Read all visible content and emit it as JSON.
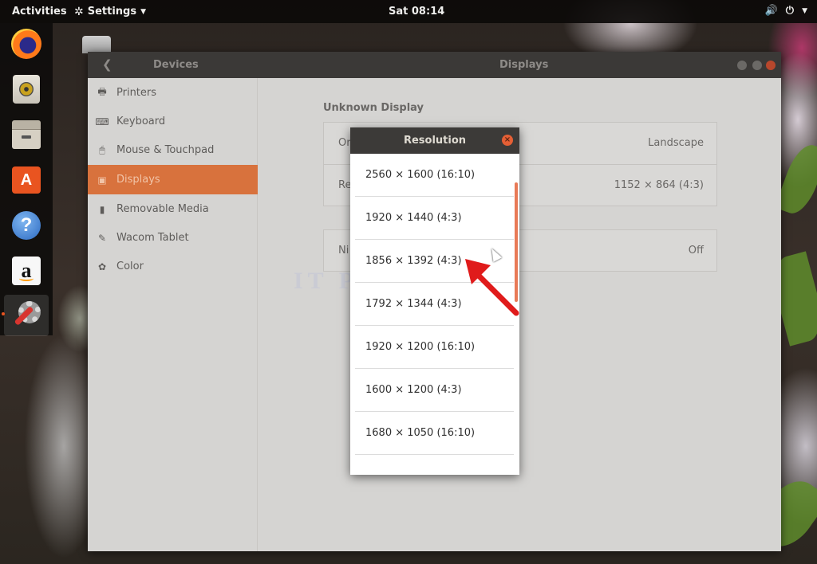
{
  "topbar": {
    "activities": "Activities",
    "app_menu": "Settings",
    "clock": "Sat 08:14"
  },
  "dock": {
    "items": [
      "firefox-icon",
      "rhythmbox-icon",
      "files-icon",
      "software-center-icon",
      "help-icon",
      "amazon-icon",
      "settings-icon"
    ],
    "active": "settings-icon"
  },
  "window": {
    "sidebar_title": "Devices",
    "title": "Displays",
    "sidebar": {
      "items": [
        {
          "label": "Printers",
          "icon": "printer-icon"
        },
        {
          "label": "Keyboard",
          "icon": "keyboard-icon"
        },
        {
          "label": "Mouse & Touchpad",
          "icon": "mouse-icon"
        },
        {
          "label": "Displays",
          "icon": "display-icon",
          "selected": true
        },
        {
          "label": "Removable Media",
          "icon": "usb-icon"
        },
        {
          "label": "Wacom Tablet",
          "icon": "tablet-icon"
        },
        {
          "label": "Color",
          "icon": "color-icon"
        }
      ]
    },
    "main": {
      "section_title": "Unknown Display",
      "rows": [
        {
          "label": "Or",
          "value": "Landscape"
        },
        {
          "label": "Re",
          "value": "1152 × 864 (4:3)"
        },
        {
          "label": "Ni",
          "value": "Off"
        }
      ]
    }
  },
  "dialog": {
    "title": "Resolution",
    "resolutions": [
      "2560 × 1600 (16:10)",
      "1920 × 1440 (4:3)",
      "1856 × 1392 (4:3)",
      "1792 × 1344 (4:3)",
      "1920 × 1200 (16:10)",
      "1600 × 1200 (4:3)",
      "1680 × 1050 (16:10)",
      ""
    ]
  },
  "overlay": {
    "watermark": "IT Pros",
    "arrow_color": "#e01b1b"
  },
  "colors": {
    "accent": "#e95420",
    "selected_sidebar": "#d8723d"
  }
}
